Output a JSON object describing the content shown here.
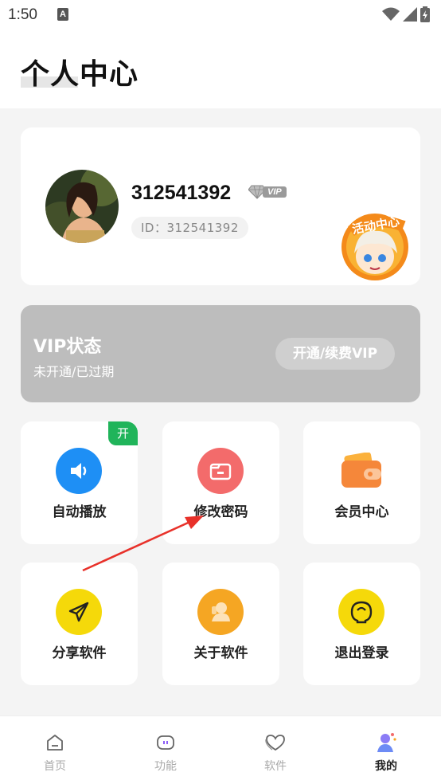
{
  "status_bar": {
    "time": "1:50",
    "notif_glyph": "A"
  },
  "header": {
    "title": "个人中心"
  },
  "profile": {
    "username": "312541392",
    "vip_badge": "VIP",
    "user_id": "ID：312541392",
    "activity_text": "活动中心"
  },
  "vip_status": {
    "title": "VIP状态",
    "subtitle": "未开通/已过期",
    "button_label": "开通/续费VIP"
  },
  "features": [
    {
      "label": "自动播放",
      "icon": "speaker-icon",
      "color": "#1e8ff5",
      "tag": "开"
    },
    {
      "label": "修改密码",
      "icon": "folder-lock-icon",
      "color": "#f36b6b"
    },
    {
      "label": "会员中心",
      "icon": "wallet-icon",
      "color": "#f5873a"
    },
    {
      "label": "分享软件",
      "icon": "paper-plane-icon",
      "color": "#f5d90a"
    },
    {
      "label": "关于软件",
      "icon": "person-icon",
      "color": "#f5a623"
    },
    {
      "label": "退出登录",
      "icon": "face-icon",
      "color": "#f5d90a"
    }
  ],
  "nav": [
    {
      "label": "首页",
      "icon": "home-icon"
    },
    {
      "label": "功能",
      "icon": "feature-icon"
    },
    {
      "label": "软件",
      "icon": "heart-icon"
    },
    {
      "label": "我的",
      "icon": "profile-icon",
      "active": true
    }
  ],
  "colors": {
    "vip_bar": "#bdbdbd",
    "tag_green": "#20b45a",
    "annotation_arrow": "#e8312a"
  }
}
